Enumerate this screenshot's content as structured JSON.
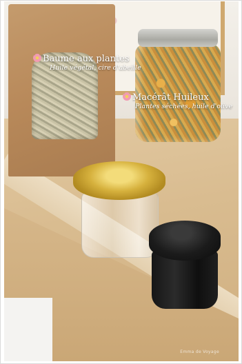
{
  "caption_baume": {
    "icon": "flower-icon",
    "title": "Baume aux plantes",
    "subtitle": "Huile végétal, cire d'abeille"
  },
  "caption_macerat": {
    "icon": "flower-icon",
    "title": "Macérât Huileux",
    "subtitle": "Plantes séchées, huile d'olive"
  },
  "watermark": "Emma de Voyage",
  "colors": {
    "caption_text": "#ffffff",
    "flower_petal": "#f29bb2",
    "gold_lid": "#d6b13d",
    "black_jar": "#111111",
    "kraft_bag": "#b8895a"
  }
}
